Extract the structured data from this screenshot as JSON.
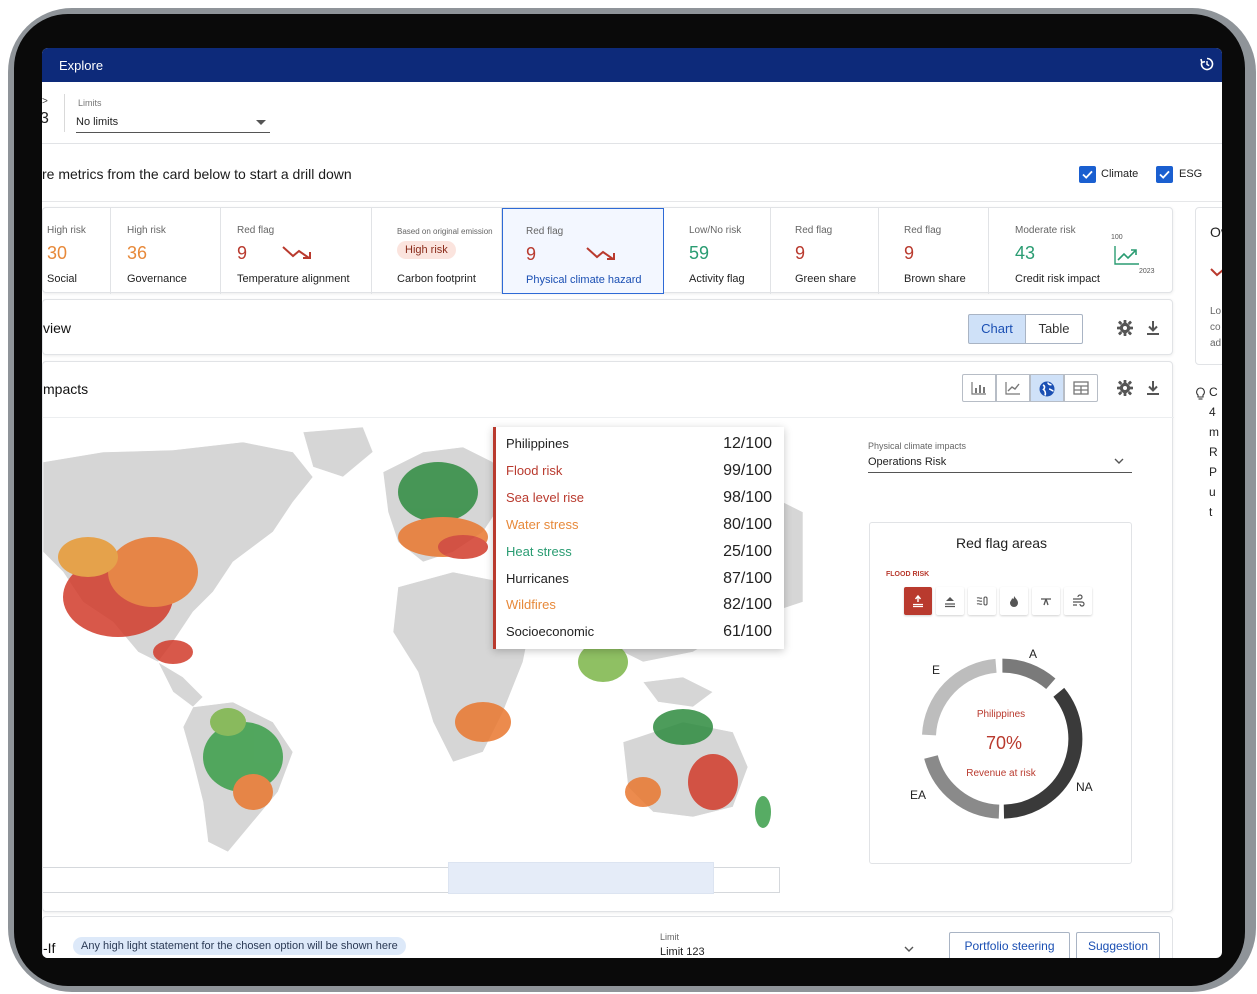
{
  "app": {
    "title": "Explore"
  },
  "filters": {
    "crumb_arrow": ">",
    "crumb_value": "3",
    "limits_label": "Limits",
    "limits_value": "No limits"
  },
  "instruction": {
    "text": "re metrics from the card below to start a drill down",
    "checkboxes": [
      {
        "label": "Climate",
        "checked": true
      },
      {
        "label": "ESG",
        "checked": true
      }
    ]
  },
  "cards": [
    {
      "label": "High risk",
      "value": "30",
      "name": "Social",
      "color": "#e7893a"
    },
    {
      "label": "High risk",
      "value": "36",
      "name": "Governance",
      "color": "#e7893a"
    },
    {
      "label": "Red flag",
      "value": "9",
      "name": "Temperature alignment",
      "color": "#b93a2e"
    },
    {
      "label": "Based on original emission",
      "pill": "High risk",
      "name": "Carbon footprint"
    },
    {
      "label": "Red flag",
      "value": "9",
      "name": "Physical climate hazard",
      "color": "#b93a2e",
      "selected": true
    },
    {
      "label": "Low/No risk",
      "value": "59",
      "name": "Activity flag",
      "color": "#2a9c72"
    },
    {
      "label": "Red flag",
      "value": "9",
      "name": "Green share",
      "color": "#b93a2e"
    },
    {
      "label": "Red flag",
      "value": "9",
      "name": "Brown share",
      "color": "#b93a2e"
    },
    {
      "label": "Moderate risk",
      "value": "43",
      "name": "Credit risk impact",
      "color": "#2a9c72",
      "spark_top": "100",
      "spark_year": "2023"
    }
  ],
  "side_panel": {
    "title": "Ov",
    "lines": [
      "Lo",
      "co",
      "ad"
    ]
  },
  "overview": {
    "title": "view",
    "toggle": {
      "chart": "Chart",
      "table": "Table",
      "active": "chart"
    }
  },
  "impacts": {
    "title": "mpacts",
    "tooltip": [
      {
        "label": "Philippines",
        "value": "12/100",
        "color": "#222222"
      },
      {
        "label": "Flood risk",
        "value": "99/100",
        "color": "#b93a2e"
      },
      {
        "label": "Sea level rise",
        "value": "98/100",
        "color": "#b93a2e"
      },
      {
        "label": "Water stress",
        "value": "80/100",
        "color": "#e7893a"
      },
      {
        "label": "Heat stress",
        "value": "25/100",
        "color": "#2a9c72"
      },
      {
        "label": "Hurricanes",
        "value": "87/100",
        "color": "#222222"
      },
      {
        "label": "Wildfires",
        "value": "82/100",
        "color": "#e7893a"
      },
      {
        "label": "Socioeconomic",
        "value": "61/100",
        "color": "#222222"
      }
    ],
    "selector_label": "Physical climate impacts",
    "selector_value": "Operations Risk",
    "red_flag": {
      "title": "Red flag areas",
      "active_hazard": "FLOOD RISK",
      "hazard_icons": [
        "flood-icon",
        "sea-level-icon",
        "water-stress-icon",
        "wildfire-icon",
        "hurricane-icon",
        "wind-icon"
      ],
      "region_labels": {
        "a": "A",
        "e": "E",
        "ea": "EA",
        "na": "NA"
      },
      "center_country": "Philippines",
      "center_value": "70%",
      "center_caption": "Revenue at risk"
    }
  },
  "what_if": {
    "title": "-If",
    "highlight": "Any high light statement for the chosen option will be shown here",
    "limit_label": "Limit",
    "limit_value": "Limit 123",
    "buttons": [
      "Portfolio steering",
      "Suggestion"
    ]
  },
  "hint": {
    "lines": [
      "C",
      "4",
      "m",
      "R",
      "P",
      "u",
      "t"
    ]
  },
  "colors": {
    "topbar": "#0d2a7a",
    "accent": "#1a5fd0",
    "red": "#b93a2e",
    "orange": "#e7893a",
    "green": "#2a9c72"
  }
}
